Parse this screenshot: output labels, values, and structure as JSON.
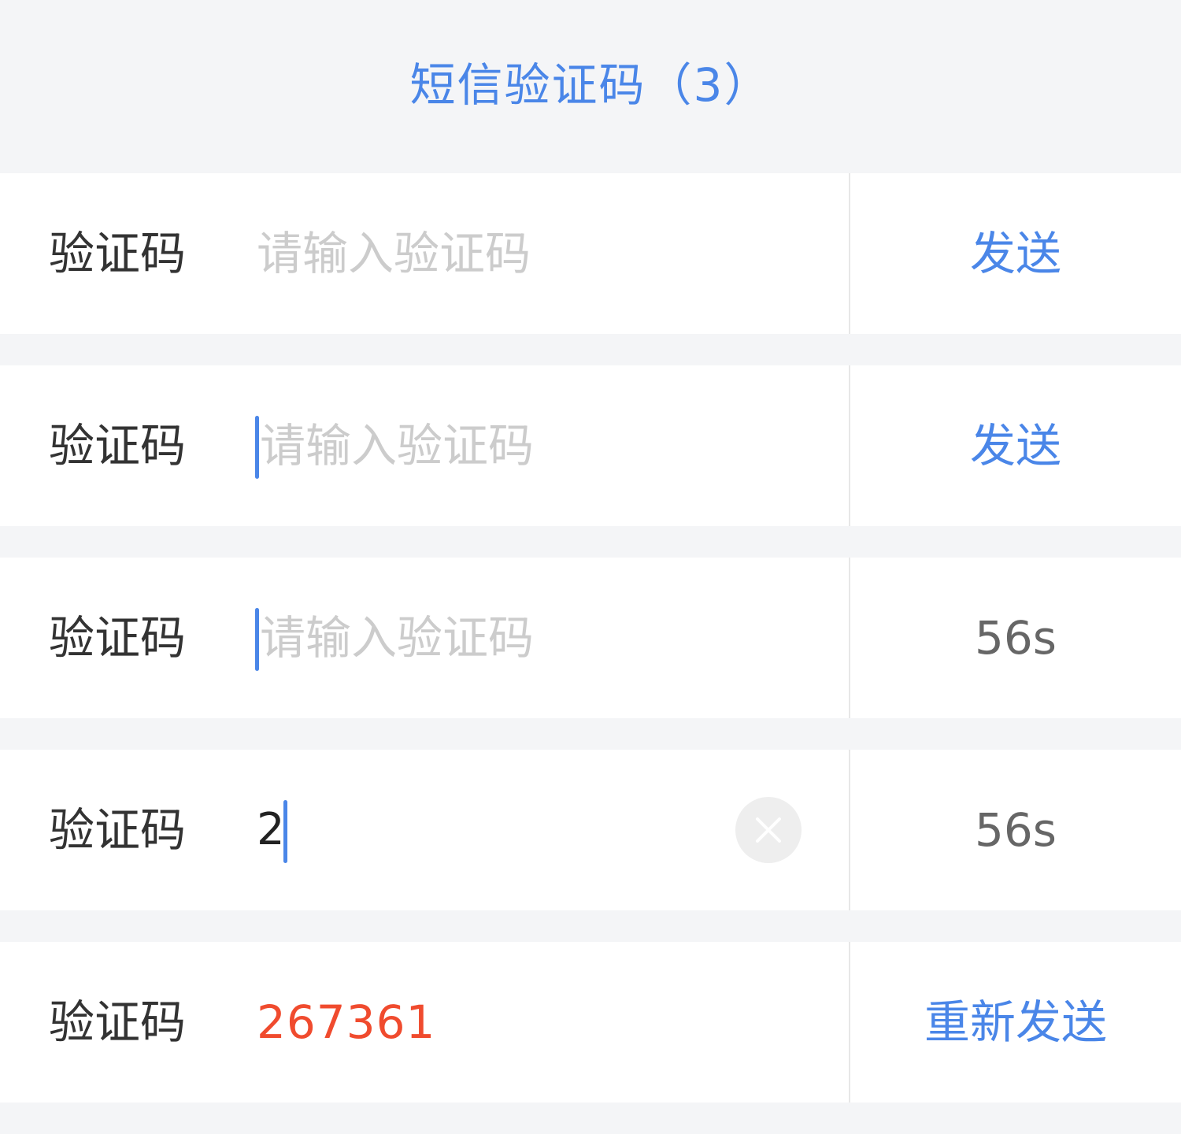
{
  "colors": {
    "accent": "#4a86e8",
    "label": "#333333",
    "placeholder": "#cccccc",
    "countdown": "#666666",
    "code": "#f04b2e",
    "background": "#f4f5f7"
  },
  "header": {
    "title": "短信验证码（3）"
  },
  "rows": [
    {
      "label": "验证码",
      "placeholder": "请输入验证码",
      "focused": false,
      "action": "发送",
      "action_state": "active"
    },
    {
      "label": "验证码",
      "placeholder": "请输入验证码",
      "focused": true,
      "action": "发送",
      "action_state": "active"
    },
    {
      "label": "验证码",
      "placeholder": "请输入验证码",
      "focused": true,
      "action": "56s",
      "action_state": "countdown"
    },
    {
      "label": "验证码",
      "value": "2",
      "focused": true,
      "clear_icon": "close-circle-icon",
      "action": "56s",
      "action_state": "countdown"
    },
    {
      "label": "验证码",
      "code": "267361",
      "focused": false,
      "action": "重新发送",
      "action_state": "active"
    }
  ]
}
